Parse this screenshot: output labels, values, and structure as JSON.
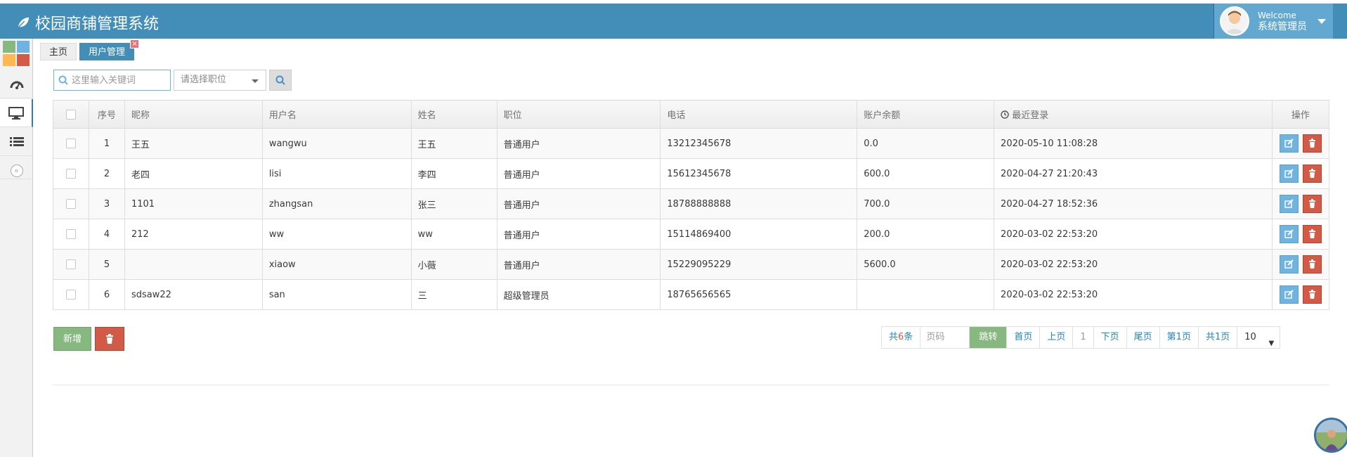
{
  "app": {
    "title": "校园商铺管理系统"
  },
  "user": {
    "welcome": "Welcome",
    "name": "系统管理员"
  },
  "sidebar": {
    "shortcut_colors": [
      "#87b87f",
      "#6fb3e0",
      "#ffb752",
      "#d15b47"
    ],
    "items": [
      {
        "icon": "dashboard-icon"
      },
      {
        "icon": "desktop-icon",
        "active": true
      },
      {
        "icon": "list-icon"
      }
    ],
    "collapse_icon": "double-chevron-left-icon",
    "collapse_glyph": "«"
  },
  "tabs": [
    {
      "label": "主页"
    },
    {
      "label": "用户管理",
      "active": true,
      "close": "×"
    }
  ],
  "search": {
    "placeholder": "这里输入关键词",
    "select_placeholder": "请选择职位"
  },
  "table": {
    "headers": [
      "",
      "序号",
      "昵称",
      "用户名",
      "姓名",
      "职位",
      "电话",
      "账户余额",
      "最近登录",
      "操作"
    ],
    "rows": [
      {
        "no": "1",
        "nickname": "王五",
        "username": "wangwu",
        "name": "王五",
        "role": "普通用户",
        "phone": "13212345678",
        "balance": "0.0",
        "last_login": "2020-05-10 11:08:28"
      },
      {
        "no": "2",
        "nickname": "老四",
        "username": "lisi",
        "name": "李四",
        "role": "普通用户",
        "phone": "15612345678",
        "balance": "600.0",
        "last_login": "2020-04-27 21:20:43"
      },
      {
        "no": "3",
        "nickname": "1101",
        "username": "zhangsan",
        "name": "张三",
        "role": "普通用户",
        "phone": "18788888888",
        "balance": "700.0",
        "last_login": "2020-04-27 18:52:36"
      },
      {
        "no": "4",
        "nickname": "212",
        "username": "ww",
        "name": "ww",
        "role": "普通用户",
        "phone": "15114869400",
        "balance": "200.0",
        "last_login": "2020-03-02 22:53:20"
      },
      {
        "no": "5",
        "nickname": "",
        "username": "xiaow",
        "name": "小薇",
        "role": "普通用户",
        "phone": "15229095229",
        "balance": "5600.0",
        "last_login": "2020-03-02 22:53:20"
      },
      {
        "no": "6",
        "nickname": "sdsaw22",
        "username": "san",
        "name": "三",
        "role": "超级管理员",
        "phone": "18765656565",
        "balance": "",
        "last_login": "2020-03-02 22:53:20"
      }
    ]
  },
  "actions": {
    "add_label": "新增"
  },
  "pager": {
    "total_prefix": "共",
    "total_count": "6",
    "total_suffix": "条",
    "page_input_placeholder": "页码",
    "jump": "跳转",
    "first": "首页",
    "prev": "上页",
    "current": "1",
    "next": "下页",
    "last": "尾页",
    "page_of": "第1页",
    "total_pages": "共1页",
    "page_size": "10"
  },
  "colors": {
    "header": "#438eb9",
    "accent": "#6fb3e0",
    "success": "#87b87f",
    "danger": "#d15b47"
  }
}
